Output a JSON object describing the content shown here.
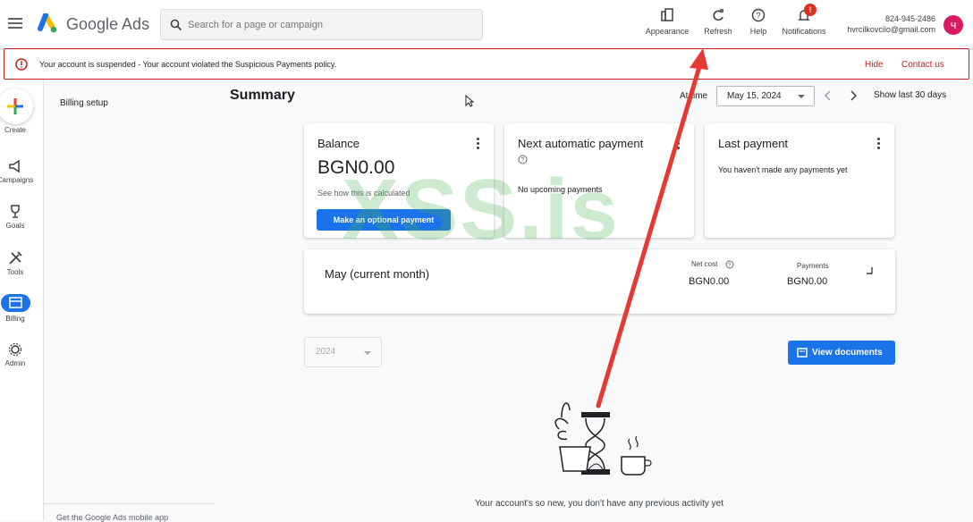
{
  "topbar": {
    "brand": "Google Ads",
    "search_placeholder": "Search for a page or campaign",
    "actions": [
      {
        "label": "Appearance",
        "icon": "appearance-icon"
      },
      {
        "label": "Refresh",
        "icon": "refresh-icon"
      },
      {
        "label": "Help",
        "icon": "help-icon"
      },
      {
        "label": "Notifications",
        "icon": "notifications-icon",
        "badge": "!"
      }
    ],
    "account_id": "824-945-2486",
    "account_email": "hvrcilkovcilo@gmail.com",
    "avatar_letter": "ч",
    "avatar_color": "#d81b60"
  },
  "alert": {
    "title": "Your account is suspended",
    "message": " - Your account violated the Suspicious Payments policy.",
    "hide": "Hide",
    "contact": "Contact us",
    "color": "#c5221f"
  },
  "rail": {
    "items": [
      {
        "label": "Create",
        "icon": "create-plus-icon"
      },
      {
        "label": "Campaigns",
        "icon": "campaigns-icon"
      },
      {
        "label": "Goals",
        "icon": "goals-icon"
      },
      {
        "label": "Tools",
        "icon": "tools-icon"
      },
      {
        "label": "Billing",
        "icon": "billing-icon",
        "active": true
      },
      {
        "label": "Admin",
        "icon": "admin-icon"
      }
    ]
  },
  "subnav": {
    "billing_setup": "Billing setup",
    "mobile_app": "Get the Google Ads mobile app"
  },
  "summary": {
    "title": "Summary",
    "time_label": "At time",
    "date": "May 15, 2024",
    "show_last": "Show last 30 days"
  },
  "cards": {
    "balance": {
      "title": "Balance",
      "amount": "BGN0.00",
      "calc_link": "See how this is calculated",
      "button": "Make an optional payment"
    },
    "next_payment": {
      "title": "Next automatic payment",
      "text": "No upcoming payments"
    },
    "last_payment": {
      "title": "Last payment",
      "text": "You haven't made any payments yet"
    },
    "month": {
      "title": "May (current month)",
      "net_cost_label": "Net cost",
      "net_cost": "BGN0.00",
      "payments_label": "Payments",
      "payments": "BGN0.00"
    }
  },
  "documents": {
    "year": "2024",
    "button": "View documents"
  },
  "empty_state": {
    "text": "Your account's so new, you don't have any previous activity yet"
  },
  "watermark": "XSS.is",
  "accent": "#1a73e8"
}
